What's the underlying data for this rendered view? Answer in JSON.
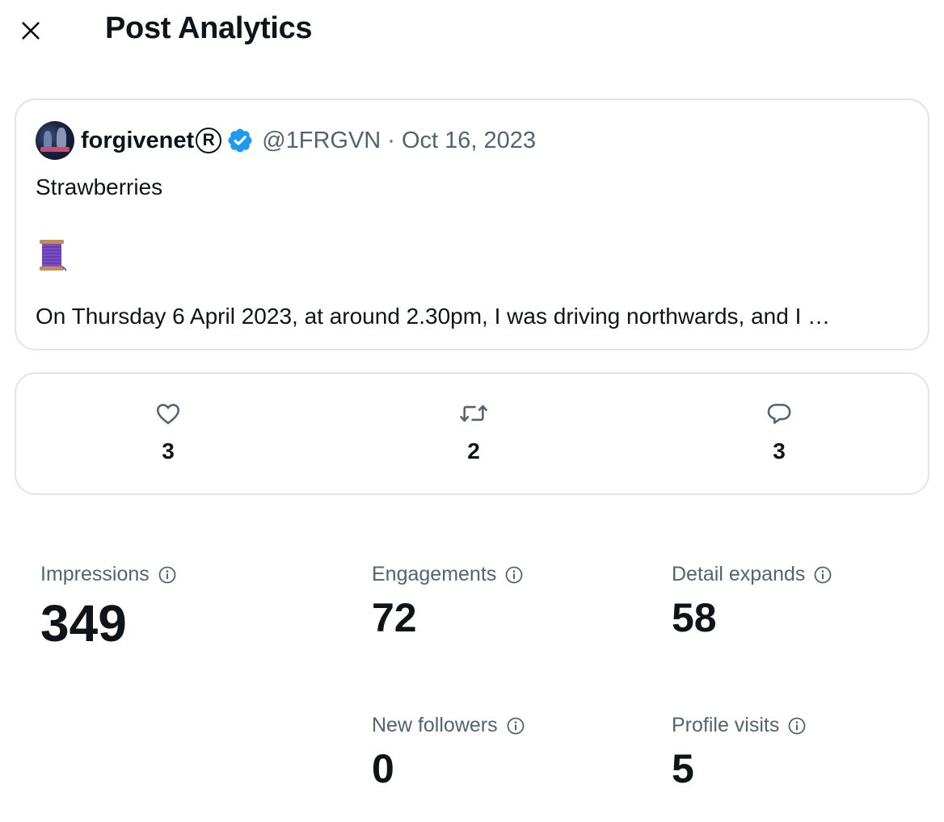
{
  "header": {
    "title": "Post Analytics",
    "close_icon": "close-icon"
  },
  "post": {
    "author_name": "forgivenet",
    "registered_mark": "R",
    "handle": "@1FRGVN",
    "separator": "·",
    "date": "Oct 16, 2023",
    "line1": "Strawberries",
    "emoji_icon": "spool-of-thread-icon",
    "line2": "On Thursday 6 April 2023, at around 2.30pm, I was driving northwards, and I …"
  },
  "engagement_counts": {
    "likes": "3",
    "reposts": "2",
    "replies": "3"
  },
  "metrics": {
    "impressions": {
      "label": "Impressions",
      "value": "349"
    },
    "engagements": {
      "label": "Engagements",
      "value": "72"
    },
    "detail_expands": {
      "label": "Detail expands",
      "value": "58"
    },
    "new_followers": {
      "label": "New followers",
      "value": "0"
    },
    "profile_visits": {
      "label": "Profile visits",
      "value": "5"
    }
  },
  "colors": {
    "verified_badge": "#1d9bf0",
    "muted_text": "#536471",
    "border": "#e1e5e8"
  }
}
